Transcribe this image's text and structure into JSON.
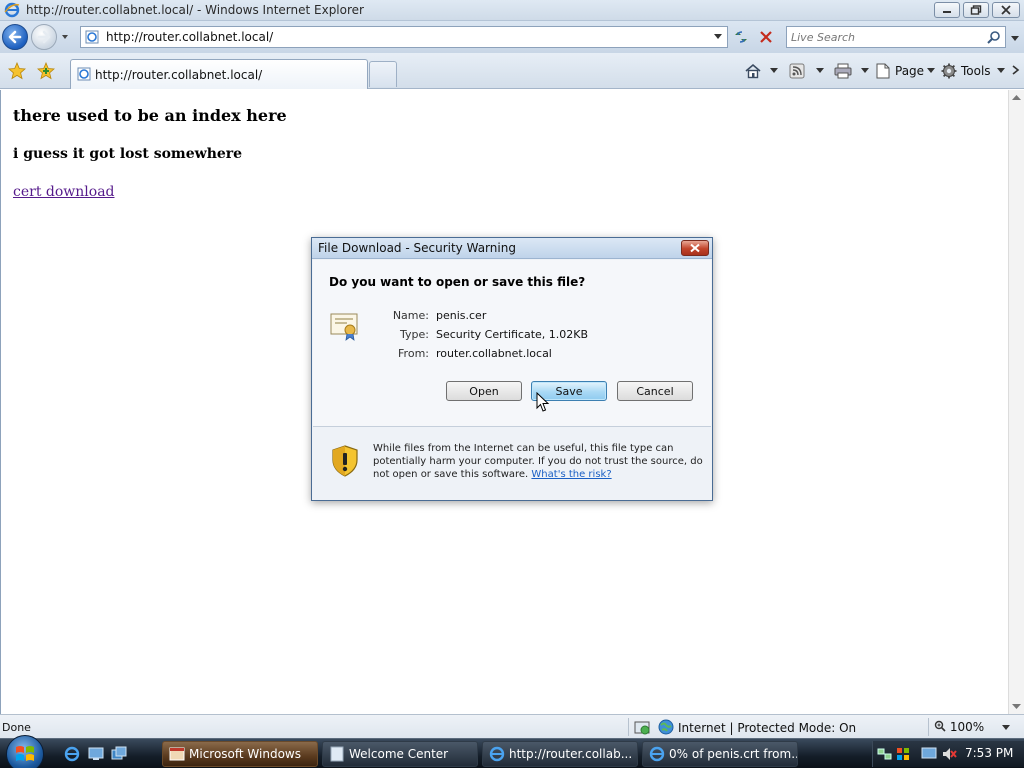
{
  "window": {
    "title": "http://router.collabnet.local/ - Windows Internet Explorer"
  },
  "address": {
    "url": "http://router.collabnet.local/"
  },
  "search": {
    "placeholder": "Live Search"
  },
  "tab": {
    "label": "http://router.collabnet.local/"
  },
  "commands": {
    "page_label": "Page",
    "tools_label": "Tools"
  },
  "page": {
    "heading": "there used to be an index here",
    "subheading": "i guess it got lost somewhere",
    "link": "cert download"
  },
  "status": {
    "text": "Done",
    "zone": "Internet | Protected Mode: On",
    "zoom": "100%"
  },
  "dialog": {
    "title": "File Download - Security Warning",
    "question": "Do you want to open or save this file?",
    "name_key": "Name:",
    "name_value": "penis.cer",
    "type_key": "Type:",
    "type_value": "Security Certificate, 1.02KB",
    "from_key": "From:",
    "from_value": "router.collabnet.local",
    "open_label": "Open",
    "save_label": "Save",
    "cancel_label": "Cancel",
    "warning_text": "While files from the Internet can be useful, this file type can potentially harm your computer. If you do not trust the source, do not open or save this software.",
    "risk_link": "What's the risk?"
  },
  "taskbar": {
    "items": [
      {
        "label": "Microsoft Windows"
      },
      {
        "label": "Welcome Center"
      },
      {
        "label": "http://router.collab..."
      },
      {
        "label": "0% of penis.crt from..."
      }
    ],
    "clock": "7:53 PM"
  },
  "colors": {
    "link_visited": "#551a8b",
    "dialog_link": "#1a5fc4",
    "ie_blue": "#1d5fbf"
  }
}
